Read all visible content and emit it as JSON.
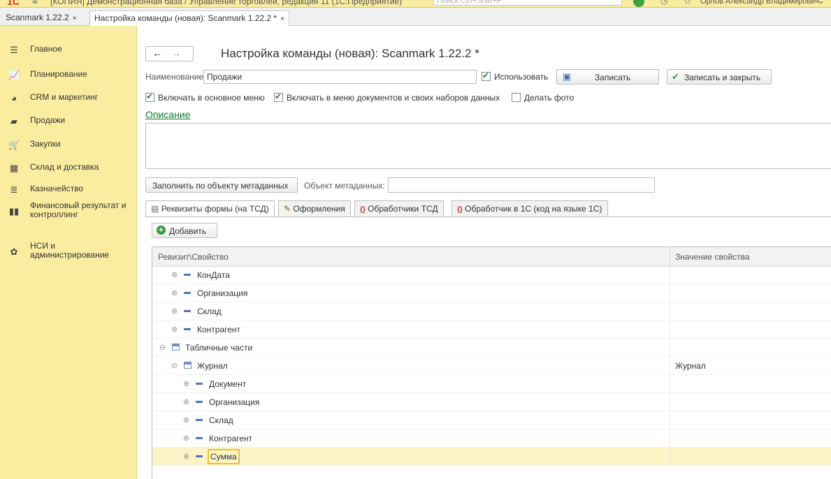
{
  "app": {
    "window_title": "[КОПИЯ] Демонстрационная база / Управление торговлей, редакция 11  (1С:Предприятие)",
    "search_placeholder": "Поиск Ctrl+Shift+F",
    "user_name": "Орлов Александр Владимирович"
  },
  "tabs": [
    {
      "label": "Scanmark 1.22.2",
      "close": "×"
    },
    {
      "label": "Настройка команды (новая): Scanmark 1.22.2 *",
      "close": "×"
    }
  ],
  "sidebar": {
    "items": [
      {
        "label": "Главное",
        "icon": "menu-icon"
      },
      {
        "label": "Планирование",
        "icon": "chart-icon"
      },
      {
        "label": "CRM и маркетинг",
        "icon": "pie-icon"
      },
      {
        "label": "Продажи",
        "icon": "bag-icon"
      },
      {
        "label": "Закупки",
        "icon": "cart-icon"
      },
      {
        "label": "Склад и доставка",
        "icon": "warehouse-icon"
      },
      {
        "label": "Казначейство",
        "icon": "coins-icon"
      },
      {
        "label": "Финансовый результат и контроллинг",
        "icon": "bar-chart-icon"
      },
      {
        "label": "НСИ и администрирование",
        "icon": "gear-icon"
      }
    ]
  },
  "form": {
    "title": "Настройка команды (новая): Scanmark 1.22.2 *",
    "name_label": "Наименование:",
    "name_value": "Продажи",
    "use_label": "Использовать",
    "save_label": "Записать",
    "save_close_label": "Записать и закрыть",
    "opt_main_menu": "Включать в основное меню",
    "opt_doc_menu": "Включать в меню документов и своих наборов данных",
    "opt_photo": "Делать фото",
    "description_link": "Описание",
    "fill_button": "Заполнить по объекту метаданных",
    "metadata_label": "Объект метаданных:",
    "metadata_value": ""
  },
  "form_tabs": [
    {
      "label": "Реквизиты формы (на ТСД)",
      "icon": "form-icon"
    },
    {
      "label": "Оформления",
      "icon": "brush-icon"
    },
    {
      "label": "Обработчики ТСД",
      "icon": "handler-icon"
    },
    {
      "label": "Обработчик в 1С  (код на языке 1С)",
      "icon": "code-icon"
    }
  ],
  "add_button": "Добавить",
  "grid": {
    "columns": [
      "Ревизит\\Свойство",
      "Значение свойства"
    ],
    "rows": [
      {
        "name": "КонДата",
        "value": "",
        "kind": "attr",
        "level": 1
      },
      {
        "name": "Организация",
        "value": "",
        "kind": "attr",
        "level": 1
      },
      {
        "name": "Склад",
        "value": "",
        "kind": "attr",
        "level": 1
      },
      {
        "name": "Контрагент",
        "value": "",
        "kind": "attr",
        "level": 1
      },
      {
        "name": "Табличные части",
        "value": "",
        "kind": "table",
        "level": 0
      },
      {
        "name": "Журнал",
        "value": "Журнал",
        "kind": "table",
        "level": 1
      },
      {
        "name": "Документ",
        "value": "",
        "kind": "attr",
        "level": 2
      },
      {
        "name": "Организация",
        "value": "",
        "kind": "attr",
        "level": 2
      },
      {
        "name": "Склад",
        "value": "",
        "kind": "attr",
        "level": 2
      },
      {
        "name": "Контрагент",
        "value": "",
        "kind": "attr",
        "level": 2
      },
      {
        "name": "Сумма",
        "value": "",
        "kind": "attr",
        "level": 2,
        "selected": true
      }
    ]
  }
}
